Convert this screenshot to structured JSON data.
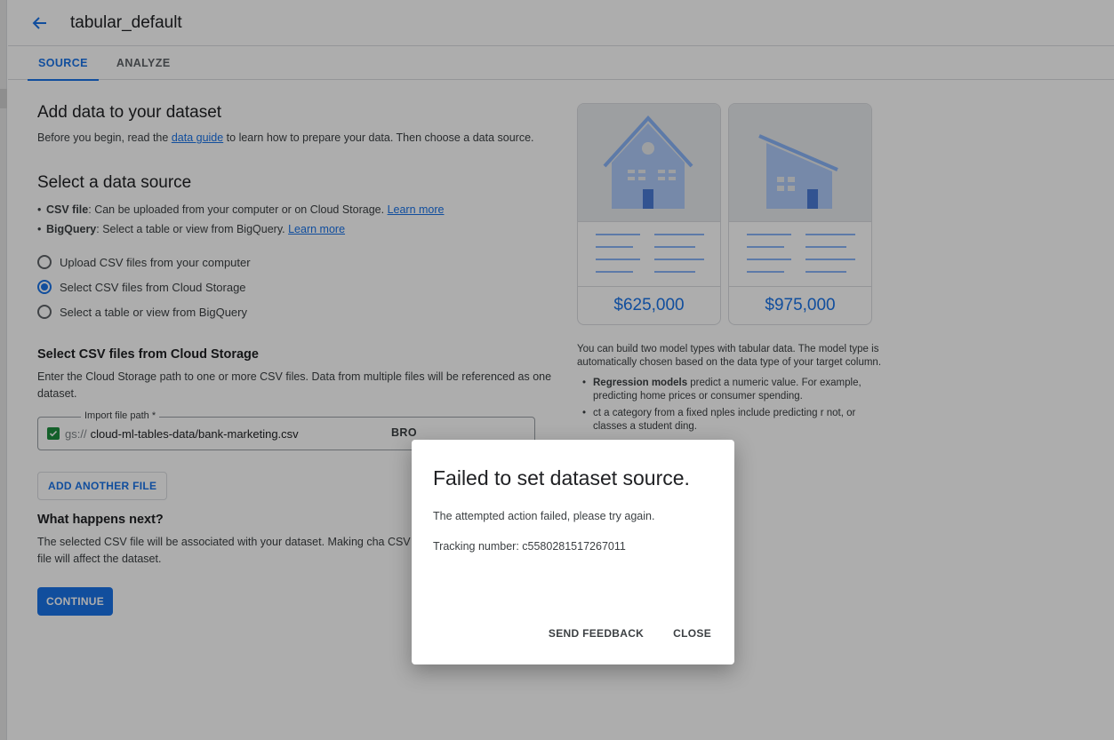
{
  "header": {
    "title": "tabular_default"
  },
  "tabs": [
    {
      "label": "SOURCE",
      "active": true
    },
    {
      "label": "ANALYZE",
      "active": false
    }
  ],
  "main": {
    "add_data_title": "Add data to your dataset",
    "intro_before": "Before you begin, read the ",
    "intro_link": "data guide",
    "intro_after": " to learn how to prepare your data. Then choose a data source.",
    "select_source_title": "Select a data source",
    "source_types": [
      {
        "name": "CSV file",
        "desc": ": Can be uploaded from your computer or on Cloud Storage. ",
        "link": "Learn more"
      },
      {
        "name": "BigQuery",
        "desc": ": Select a table or view from BigQuery. ",
        "link": "Learn more"
      }
    ],
    "radio_options": [
      {
        "label": "Upload CSV files from your computer",
        "checked": false
      },
      {
        "label": "Select CSV files from Cloud Storage",
        "checked": true
      },
      {
        "label": "Select a table or view from BigQuery",
        "checked": false
      }
    ],
    "cloud_storage_title": "Select CSV files from Cloud Storage",
    "cloud_storage_desc": "Enter the Cloud Storage path to one or more CSV files. Data from multiple files will be referenced as one dataset.",
    "import_field": {
      "label": "Import file path *",
      "prefix": "gs://",
      "value": "cloud-ml-tables-data/bank-marketing.csv",
      "browse_label": "BRO"
    },
    "add_another_file": "ADD ANOTHER FILE",
    "what_next_title": "What happens next?",
    "what_next_desc": "The selected CSV file will be associated with your dataset. Making cha CSV file will affect the dataset.",
    "continue_label": "CONTINUE"
  },
  "side": {
    "cards": [
      {
        "price": "$625,000"
      },
      {
        "price": "$975,000"
      }
    ],
    "intro": "You can build two model types with tabular data. The model type is automatically chosen based on the data type of your target column.",
    "model_types": [
      {
        "bold": "Regression models",
        "text": " predict a numeric value. For example, predicting home prices or consumer spending."
      },
      {
        "bold": "",
        "text": "ct a category from a fixed nples include predicting r not, or classes a student ding."
      }
    ]
  },
  "dialog": {
    "title": "Failed to set dataset source.",
    "message": "The attempted action failed, please try again.",
    "tracking": "Tracking number: c5580281517267011",
    "send_feedback": "SEND FEEDBACK",
    "close": "CLOSE"
  },
  "colors": {
    "accent": "#1a73e8",
    "checkbox": "#1e8e3e",
    "overlay": "rgba(0,0,0,0.32)"
  }
}
